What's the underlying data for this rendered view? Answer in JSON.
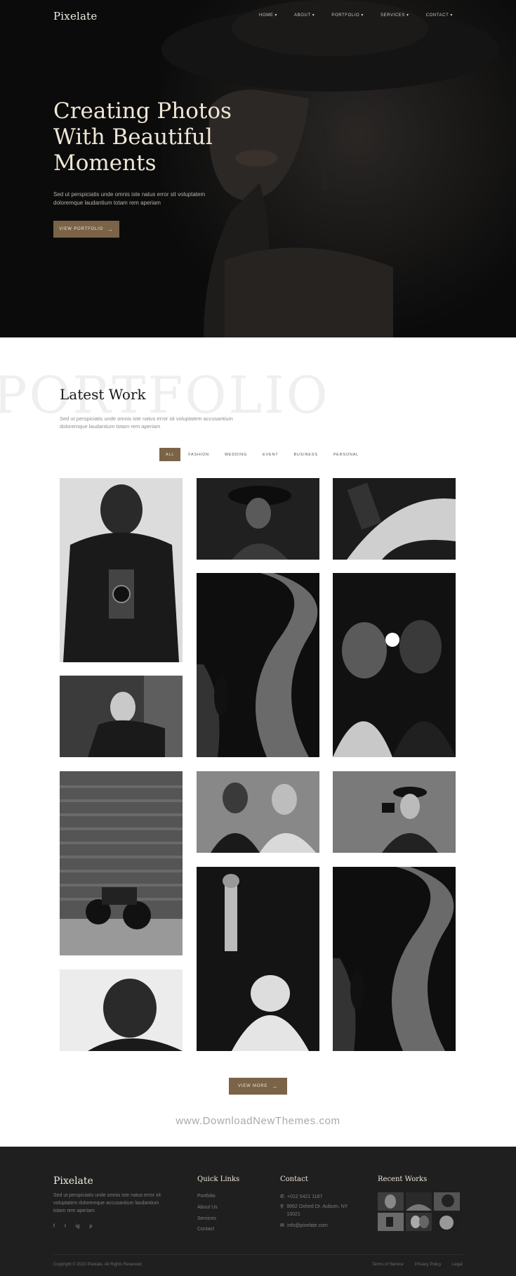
{
  "brand": "Pixelate",
  "nav": {
    "items": [
      "HOME",
      "ABOUT",
      "PORTFOLIO",
      "SERVICES",
      "CONTACT"
    ]
  },
  "hero": {
    "title_lines": [
      "Creating Photos",
      "With Beautiful",
      "Moments"
    ],
    "subtitle": "Sed ut perspiciatis unde omnis iste natus error sit voluptatem doloremque laudantium totam rem aperiam",
    "button": "VIEW PORTFOLIO"
  },
  "portfolio": {
    "background_word": "PORTFOLIO",
    "title": "Latest Work",
    "subtitle": "Sed ut perspiciatis unde omnis iste natus error sit voluptatem accusantium doloremque laudantium totam rem aperiam",
    "filters": [
      "ALL",
      "FASHION",
      "WEDDING",
      "EVENT",
      "BUSINESS",
      "PERSONAL"
    ],
    "active_filter": "ALL",
    "more_button": "VIEW MORE"
  },
  "watermark": "www.DownloadNewThemes.com",
  "footer": {
    "brand": "Pixelate",
    "description": "Sed ut perspiciatis unde omnis iste natus error sit voluptatem doloremque accusantium laudantium totam rem aperiam",
    "social": [
      "f",
      "t",
      "ig",
      "p"
    ],
    "quick_links": {
      "title": "Quick Links",
      "items": [
        "Portfolio",
        "About Us",
        "Services",
        "Contact"
      ]
    },
    "contact": {
      "title": "Contact",
      "phone": "+012 5421 1187",
      "address": "9962 Oxford Dr. Auburn, NY 13021",
      "email": "info@pixelate.com"
    },
    "recent_works": {
      "title": "Recent Works"
    },
    "copyright": "Copyright © 2020 Pixelate. All Rights Reserved.",
    "legal_links": [
      "Terms of Service",
      "Privacy Policy",
      "Legal"
    ]
  },
  "colors": {
    "accent": "#7a6347",
    "hero_bg": "#0b0b0b",
    "footer_bg": "#1f1f1f"
  }
}
